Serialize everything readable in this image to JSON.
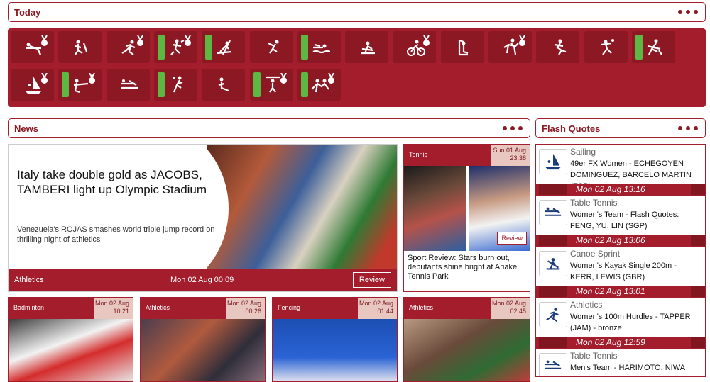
{
  "today": {
    "title": "Today"
  },
  "sports": [
    {
      "icon": "gymnastics-bar-icon",
      "live": false,
      "medal": true
    },
    {
      "icon": "trampoline-icon",
      "live": false,
      "medal": false
    },
    {
      "icon": "athletics-icon",
      "live": false,
      "medal": true
    },
    {
      "icon": "artistic-swimming-icon",
      "live": true,
      "medal": true
    },
    {
      "icon": "canoe-slalom-icon",
      "live": true,
      "medal": false
    },
    {
      "icon": "diving-icon",
      "live": false,
      "medal": false
    },
    {
      "icon": "swimming-icon",
      "live": true,
      "medal": false
    },
    {
      "icon": "rowing-icon",
      "live": false,
      "medal": false
    },
    {
      "icon": "cycling-track-icon",
      "live": false,
      "medal": true
    },
    {
      "icon": "golf-icon",
      "live": false,
      "medal": false
    },
    {
      "icon": "equestrian-icon",
      "live": false,
      "medal": true
    },
    {
      "icon": "football-icon",
      "live": false,
      "medal": false
    },
    {
      "icon": "handball-icon",
      "live": false,
      "medal": false
    },
    {
      "icon": "hockey-icon",
      "live": true,
      "medal": false
    },
    {
      "icon": "sailing-icon",
      "live": false,
      "medal": true
    },
    {
      "icon": "shooting-icon",
      "live": true,
      "medal": true
    },
    {
      "icon": "table-tennis-icon",
      "live": false,
      "medal": false
    },
    {
      "icon": "volleyball-icon",
      "live": true,
      "medal": false
    },
    {
      "icon": "water-polo-icon",
      "live": false,
      "medal": false
    },
    {
      "icon": "weightlifting-icon",
      "live": true,
      "medal": true
    },
    {
      "icon": "wrestling-icon",
      "live": true,
      "medal": true
    }
  ],
  "news": {
    "title": "News",
    "hero": {
      "headline": "Italy take double gold as JACOBS, TAMBERI light up Olympic Stadium",
      "summary": "Venezuela's ROJAS smashes world triple jump record on thrilling night of athletics",
      "category": "Athletics",
      "date": "Mon 02 Aug 00:09",
      "button": "Review"
    },
    "tennis": {
      "category": "Tennis",
      "date_line1": "Sun 01 Aug",
      "date_line2": "23:38",
      "button": "Review",
      "text": "Sport Review: Stars burn out, debutants shine bright at Ariake Tennis Park"
    },
    "cards": [
      {
        "category": "Badminton",
        "date_line1": "Mon 02 Aug",
        "date_line2": "10:21"
      },
      {
        "category": "Athletics",
        "date_line1": "Mon 02 Aug",
        "date_line2": "00:26"
      },
      {
        "category": "Fencing",
        "date_line1": "Mon 02 Aug",
        "date_line2": "01:44"
      },
      {
        "category": "Athletics",
        "date_line1": "Mon 02 Aug",
        "date_line2": "02:45"
      }
    ]
  },
  "flash": {
    "title": "Flash Quotes",
    "items": [
      {
        "sport": "Sailing",
        "text": "49er FX Women - ECHEGOYEN DOMINGUEZ, BARCELO MARTIN (ESP)",
        "time": "Mon 02 Aug 13:16",
        "icon": "sailing-icon"
      },
      {
        "sport": "Table Tennis",
        "text": "Women's Team - Flash Quotes: FENG, YU, LIN (SGP)",
        "time": "Mon 02 Aug 13:06",
        "icon": "table-tennis-icon"
      },
      {
        "sport": "Canoe Sprint",
        "text": "Women's Kayak Single 200m - KERR, LEWIS (GBR)",
        "time": "Mon 02 Aug 13:01",
        "icon": "canoe-sprint-icon"
      },
      {
        "sport": "Athletics",
        "text": "Women's 100m Hurdles - TAPPER (JAM) - bronze",
        "time": "Mon 02 Aug 12:59",
        "icon": "athletics-icon"
      },
      {
        "sport": "Table Tennis",
        "text": "Men's Team - HARIMOTO, NIWA",
        "time": "",
        "icon": "table-tennis-icon"
      }
    ]
  },
  "colors": {
    "brand": "#a31d2c",
    "live": "#5cb843"
  }
}
